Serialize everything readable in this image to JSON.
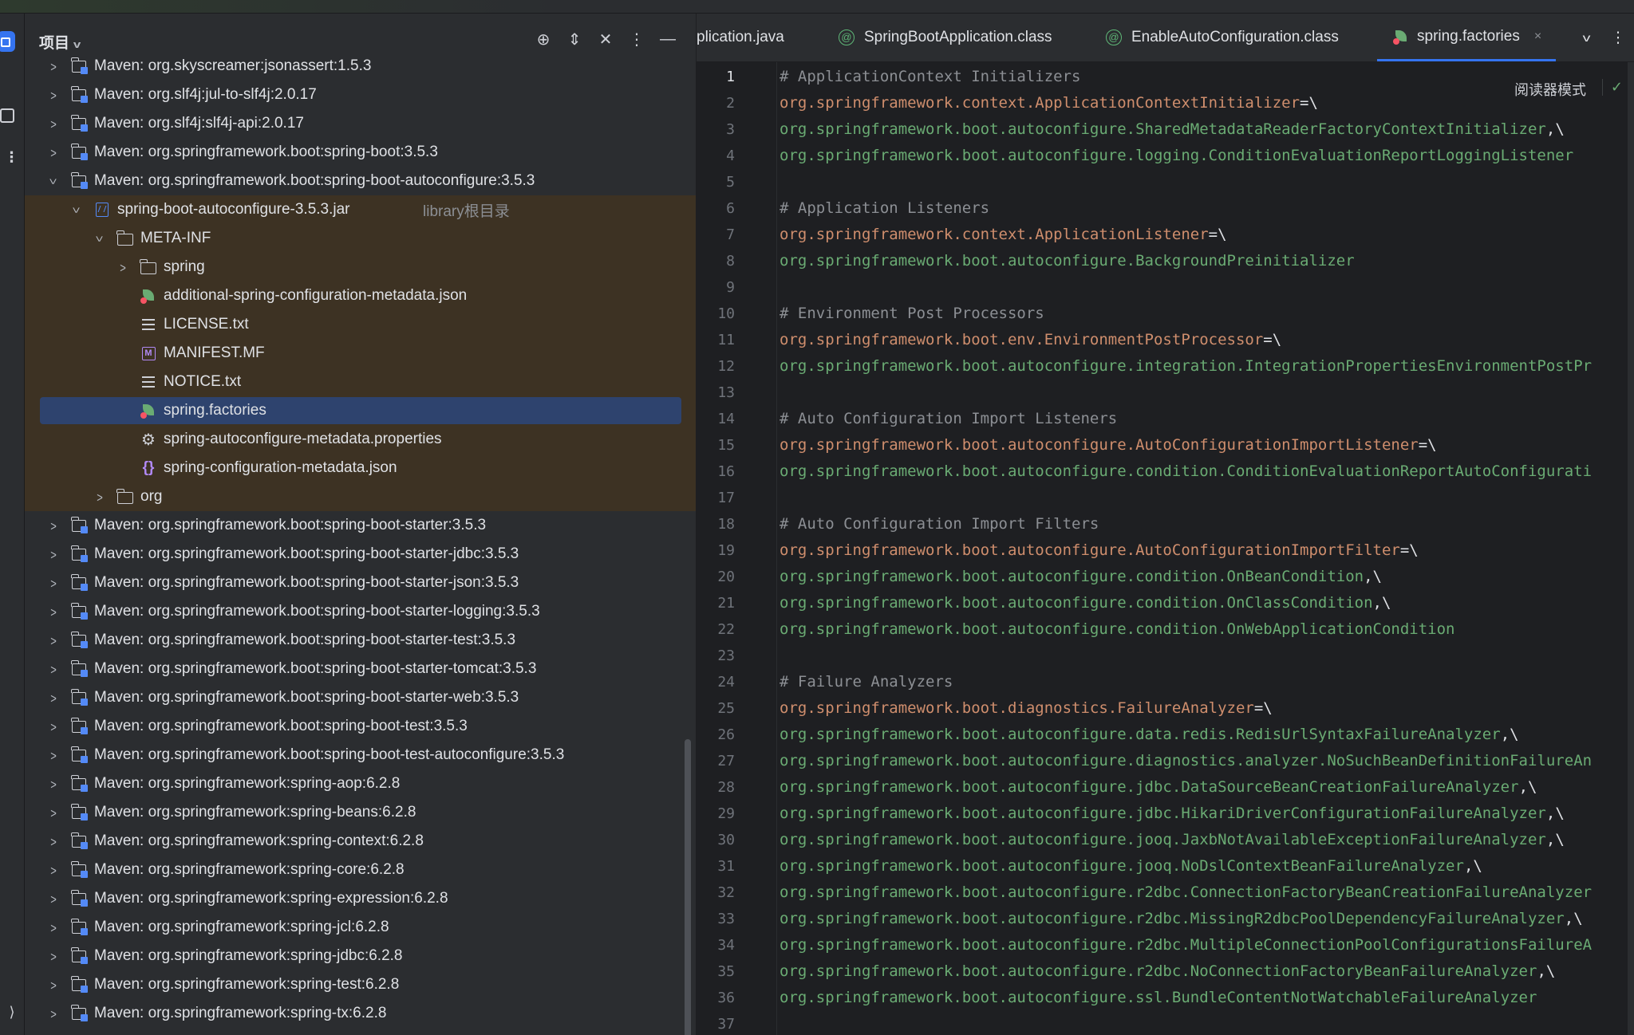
{
  "project_panel": {
    "title": "项目",
    "tree": [
      {
        "label": "Maven: org.skyscreamer:jsonassert:1.5.3",
        "icon": "library-icon",
        "depth": 0,
        "expanded": false
      },
      {
        "label": "Maven: org.slf4j:jul-to-slf4j:2.0.17",
        "icon": "library-icon",
        "depth": 0,
        "expanded": false
      },
      {
        "label": "Maven: org.slf4j:slf4j-api:2.0.17",
        "icon": "library-icon",
        "depth": 0,
        "expanded": false
      },
      {
        "label": "Maven: org.springframework.boot:spring-boot:3.5.3",
        "icon": "library-icon",
        "depth": 0,
        "expanded": false
      },
      {
        "label": "Maven: org.springframework.boot:spring-boot-autoconfigure:3.5.3",
        "icon": "library-icon",
        "depth": 0,
        "expanded": true
      },
      {
        "label": "spring-boot-autoconfigure-3.5.3.jar",
        "hint": "library根目录",
        "icon": "jar-icon",
        "depth": 1,
        "expanded": true
      },
      {
        "label": "META-INF",
        "icon": "folder-icon",
        "depth": 2,
        "expanded": true
      },
      {
        "label": "spring",
        "icon": "folder-icon",
        "depth": 3,
        "expanded": false
      },
      {
        "label": "additional-spring-configuration-metadata.json",
        "icon": "spring-json-icon",
        "depth": 3
      },
      {
        "label": "LICENSE.txt",
        "icon": "text-file-icon",
        "depth": 3
      },
      {
        "label": "MANIFEST.MF",
        "icon": "manifest-icon",
        "depth": 3
      },
      {
        "label": "NOTICE.txt",
        "icon": "text-file-icon",
        "depth": 3
      },
      {
        "label": "spring.factories",
        "icon": "spring-factories-icon",
        "depth": 3,
        "selected": true
      },
      {
        "label": "spring-autoconfigure-metadata.properties",
        "icon": "gear-icon",
        "depth": 3
      },
      {
        "label": "spring-configuration-metadata.json",
        "icon": "json-icon",
        "depth": 3
      },
      {
        "label": "org",
        "icon": "folder-icon",
        "depth": 2,
        "expanded": false
      },
      {
        "label": "Maven: org.springframework.boot:spring-boot-starter:3.5.3",
        "icon": "library-icon",
        "depth": 0,
        "expanded": false
      },
      {
        "label": "Maven: org.springframework.boot:spring-boot-starter-jdbc:3.5.3",
        "icon": "library-icon",
        "depth": 0,
        "expanded": false
      },
      {
        "label": "Maven: org.springframework.boot:spring-boot-starter-json:3.5.3",
        "icon": "library-icon",
        "depth": 0,
        "expanded": false
      },
      {
        "label": "Maven: org.springframework.boot:spring-boot-starter-logging:3.5.3",
        "icon": "library-icon",
        "depth": 0,
        "expanded": false
      },
      {
        "label": "Maven: org.springframework.boot:spring-boot-starter-test:3.5.3",
        "icon": "library-icon",
        "depth": 0,
        "expanded": false
      },
      {
        "label": "Maven: org.springframework.boot:spring-boot-starter-tomcat:3.5.3",
        "icon": "library-icon",
        "depth": 0,
        "expanded": false
      },
      {
        "label": "Maven: org.springframework.boot:spring-boot-starter-web:3.5.3",
        "icon": "library-icon",
        "depth": 0,
        "expanded": false
      },
      {
        "label": "Maven: org.springframework.boot:spring-boot-test:3.5.3",
        "icon": "library-icon",
        "depth": 0,
        "expanded": false
      },
      {
        "label": "Maven: org.springframework.boot:spring-boot-test-autoconfigure:3.5.3",
        "icon": "library-icon",
        "depth": 0,
        "expanded": false
      },
      {
        "label": "Maven: org.springframework:spring-aop:6.2.8",
        "icon": "library-icon",
        "depth": 0,
        "expanded": false
      },
      {
        "label": "Maven: org.springframework:spring-beans:6.2.8",
        "icon": "library-icon",
        "depth": 0,
        "expanded": false
      },
      {
        "label": "Maven: org.springframework:spring-context:6.2.8",
        "icon": "library-icon",
        "depth": 0,
        "expanded": false
      },
      {
        "label": "Maven: org.springframework:spring-core:6.2.8",
        "icon": "library-icon",
        "depth": 0,
        "expanded": false
      },
      {
        "label": "Maven: org.springframework:spring-expression:6.2.8",
        "icon": "library-icon",
        "depth": 0,
        "expanded": false
      },
      {
        "label": "Maven: org.springframework:spring-jcl:6.2.8",
        "icon": "library-icon",
        "depth": 0,
        "expanded": false
      },
      {
        "label": "Maven: org.springframework:spring-jdbc:6.2.8",
        "icon": "library-icon",
        "depth": 0,
        "expanded": false
      },
      {
        "label": "Maven: org.springframework:spring-test:6.2.8",
        "icon": "library-icon",
        "depth": 0,
        "expanded": false
      },
      {
        "label": "Maven: org.springframework:spring-tx:6.2.8",
        "icon": "library-icon",
        "depth": 0,
        "expanded": false
      }
    ]
  },
  "editor": {
    "tabs": [
      {
        "label": "plication.java",
        "icon": "",
        "active": false
      },
      {
        "label": "SpringBootApplication.class",
        "icon": "annotation-icon",
        "active": false
      },
      {
        "label": "EnableAutoConfiguration.class",
        "icon": "annotation-icon",
        "active": false
      },
      {
        "label": "spring.factories",
        "icon": "spring-factories-icon",
        "active": true,
        "close": "×"
      }
    ],
    "reader_mode": "阅读器模式",
    "current_line": 1,
    "lines": [
      "# ApplicationContext Initializers",
      "org.springframework.context.ApplicationContextInitializer=\\",
      "org.springframework.boot.autoconfigure.SharedMetadataReaderFactoryContextInitializer,\\",
      "org.springframework.boot.autoconfigure.logging.ConditionEvaluationReportLoggingListener",
      "",
      "# Application Listeners",
      "org.springframework.context.ApplicationListener=\\",
      "org.springframework.boot.autoconfigure.BackgroundPreinitializer",
      "",
      "# Environment Post Processors",
      "org.springframework.boot.env.EnvironmentPostProcessor=\\",
      "org.springframework.boot.autoconfigure.integration.IntegrationPropertiesEnvironmentPostPr",
      "",
      "# Auto Configuration Import Listeners",
      "org.springframework.boot.autoconfigure.AutoConfigurationImportListener=\\",
      "org.springframework.boot.autoconfigure.condition.ConditionEvaluationReportAutoConfigurati",
      "",
      "# Auto Configuration Import Filters",
      "org.springframework.boot.autoconfigure.AutoConfigurationImportFilter=\\",
      "org.springframework.boot.autoconfigure.condition.OnBeanCondition,\\",
      "org.springframework.boot.autoconfigure.condition.OnClassCondition,\\",
      "org.springframework.boot.autoconfigure.condition.OnWebApplicationCondition",
      "",
      "# Failure Analyzers",
      "org.springframework.boot.diagnostics.FailureAnalyzer=\\",
      "org.springframework.boot.autoconfigure.data.redis.RedisUrlSyntaxFailureAnalyzer,\\",
      "org.springframework.boot.autoconfigure.diagnostics.analyzer.NoSuchBeanDefinitionFailureAn",
      "org.springframework.boot.autoconfigure.jdbc.DataSourceBeanCreationFailureAnalyzer,\\",
      "org.springframework.boot.autoconfigure.jdbc.HikariDriverConfigurationFailureAnalyzer,\\",
      "org.springframework.boot.autoconfigure.jooq.JaxbNotAvailableExceptionFailureAnalyzer,\\",
      "org.springframework.boot.autoconfigure.jooq.NoDslContextBeanFailureAnalyzer,\\",
      "org.springframework.boot.autoconfigure.r2dbc.ConnectionFactoryBeanCreationFailureAnalyzer",
      "org.springframework.boot.autoconfigure.r2dbc.MissingR2dbcPoolDependencyFailureAnalyzer,\\",
      "org.springframework.boot.autoconfigure.r2dbc.MultipleConnectionPoolConfigurationsFailureA",
      "org.springframework.boot.autoconfigure.r2dbc.NoConnectionFactoryBeanFailureAnalyzer,\\",
      "org.springframework.boot.autoconfigure.ssl.BundleContentNotWatchableFailureAnalyzer",
      ""
    ]
  },
  "colors": {
    "accent": "#3574f0",
    "selection": "#2e436e",
    "library_root_highlight": "#3d3223",
    "key_color": "#cf8e6d",
    "value_color": "#6aab73",
    "comment_color": "#8c8f94"
  }
}
